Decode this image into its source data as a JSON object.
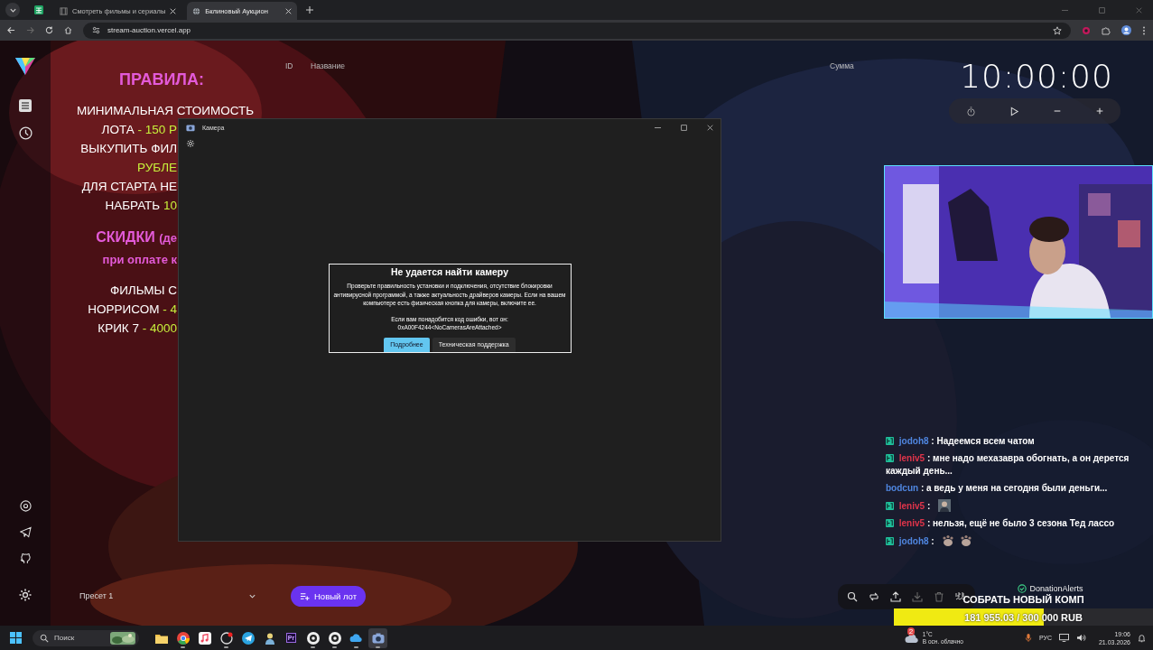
{
  "browser": {
    "tabs": [
      {
        "title": "Смотреть фильмы и сериалы",
        "selected": false
      },
      {
        "title": "Бклиновый Аукцион",
        "selected": true
      }
    ],
    "url": "stream-auction.vercel.app"
  },
  "rules": {
    "title": "ПРАВИЛА:",
    "lead": "МИНИМАЛЬНАЯ СТОИМОСТЬ",
    "sections": [
      {
        "lines": [
          {
            "kind": "text",
            "segments": [
              {
                "text": "ЛОТА ",
                "highlight": false
              },
              {
                "text": "- 150 Р",
                "highlight": true
              }
            ]
          },
          {
            "kind": "text",
            "segments": [
              {
                "text": "ВЫКУПИТЬ ФИЛ",
                "highlight": false
              }
            ]
          },
          {
            "kind": "text",
            "segments": [
              {
                "text": "РУБЛЕ",
                "highlight": true
              }
            ]
          },
          {
            "kind": "text",
            "segments": [
              {
                "text": "ДЛЯ СТАРТА НЕ",
                "highlight": false
              }
            ]
          },
          {
            "kind": "text",
            "segments": [
              {
                "text": "НАБРАТЬ ",
                "highlight": false
              },
              {
                "text": "10",
                "highlight": true
              }
            ]
          }
        ]
      },
      {
        "lines": [
          {
            "kind": "heading",
            "text": "СКИДКИ",
            "note": "(де"
          },
          {
            "kind": "subheading",
            "text": "при оплате к"
          }
        ]
      },
      {
        "lines": [
          {
            "kind": "text",
            "segments": [
              {
                "text": "ФИЛЬМЫ С",
                "highlight": false
              }
            ]
          },
          {
            "kind": "text",
            "segments": [
              {
                "text": "НОРРИСОМ ",
                "highlight": false
              },
              {
                "text": "- 4",
                "highlight": true
              }
            ]
          },
          {
            "kind": "text",
            "segments": [
              {
                "text": "КРИК 7 ",
                "highlight": false
              },
              {
                "text": "- 4000",
                "highlight": true
              }
            ]
          }
        ]
      }
    ]
  },
  "table": {
    "columns": [
      "ID",
      "Название",
      "Сумма"
    ]
  },
  "timer": {
    "time": "10:00:00"
  },
  "camera_window": {
    "title": "Камера",
    "error": {
      "title": "Не удается найти камеру",
      "message": "Проверьте правильность установки и подключения, отсутствие блокировки антивирусной программой, а также актуальность драйверов камеры. Если на вашем компьютере есть физическая кнопка для камеры, включите ее.",
      "code_intro": "Если вам понадобится код ошибки, вот он:",
      "code": "0xA00F4244<NoCamerasAreAttached>",
      "buttons": [
        {
          "label": "Подробнее",
          "selected": true
        },
        {
          "label": "Техническая поддержка",
          "selected": false
        }
      ]
    }
  },
  "chat": [
    {
      "user": "jodoh8",
      "color": "#4f86e0",
      "badge": true,
      "text": ": Надеемся всем чатом"
    },
    {
      "user": "leniv5",
      "color": "#e0344a",
      "badge": true,
      "text": ": мне надо мехазавра обогнать, а он дерется каждый день..."
    },
    {
      "user": "bodcun",
      "color": "#4f86e0",
      "badge": false,
      "text": ": а ведь у меня на сегодня были деньги..."
    },
    {
      "user": "leniv5",
      "color": "#e0344a",
      "badge": true,
      "text": ":",
      "emotes": [
        {
          "kind": "portrait"
        }
      ]
    },
    {
      "user": "leniv5",
      "color": "#e0344a",
      "badge": true,
      "text": ": нельзя, ещё не было 3 сезона Тед лассо"
    },
    {
      "user": "jodoh8",
      "color": "#4f86e0",
      "badge": true,
      "text": ":",
      "emotes": [
        {
          "kind": "paw"
        },
        {
          "kind": "paw"
        }
      ]
    }
  ],
  "preset": {
    "value": "Пресет 1"
  },
  "new_lot_button": "Новый лот",
  "toolbar": [
    {
      "kind": "search",
      "disabled": false
    },
    {
      "kind": "swap",
      "disabled": false
    },
    {
      "kind": "upload",
      "disabled": false
    },
    {
      "kind": "download",
      "disabled": true
    },
    {
      "kind": "trash",
      "disabled": true
    },
    {
      "kind": "numbers",
      "disabled": false
    }
  ],
  "donation": {
    "brand": "DonationAlerts",
    "goal": "СОБРАТЬ НОВЫЙ КОМП",
    "level": 0.58,
    "amount": "181 955.03 / 300 000 RUB"
  },
  "taskbar": {
    "search_placeholder": "Поиск",
    "apps": [
      {
        "kind": "folder",
        "running": false,
        "selected": false
      },
      {
        "kind": "chrome",
        "running": true,
        "selected": false
      },
      {
        "kind": "music",
        "running": false,
        "selected": false
      },
      {
        "kind": "record",
        "running": true,
        "selected": false
      },
      {
        "kind": "telegram",
        "running": false,
        "selected": false
      },
      {
        "kind": "person",
        "running": false,
        "selected": false
      },
      {
        "kind": "label",
        "label": "Pr",
        "running": false,
        "selected": false
      },
      {
        "kind": "ring",
        "running": true,
        "selected": false
      },
      {
        "kind": "ring",
        "running": true,
        "selected": false
      },
      {
        "kind": "cloud",
        "running": true,
        "selected": false
      },
      {
        "kind": "camera",
        "running": true,
        "selected": true
      }
    ],
    "weather": {
      "temp": "1°C",
      "desc": "В осн. облачно",
      "badge": "2"
    },
    "language": "РУС",
    "time": "19:06",
    "date": "21.03.2026"
  }
}
